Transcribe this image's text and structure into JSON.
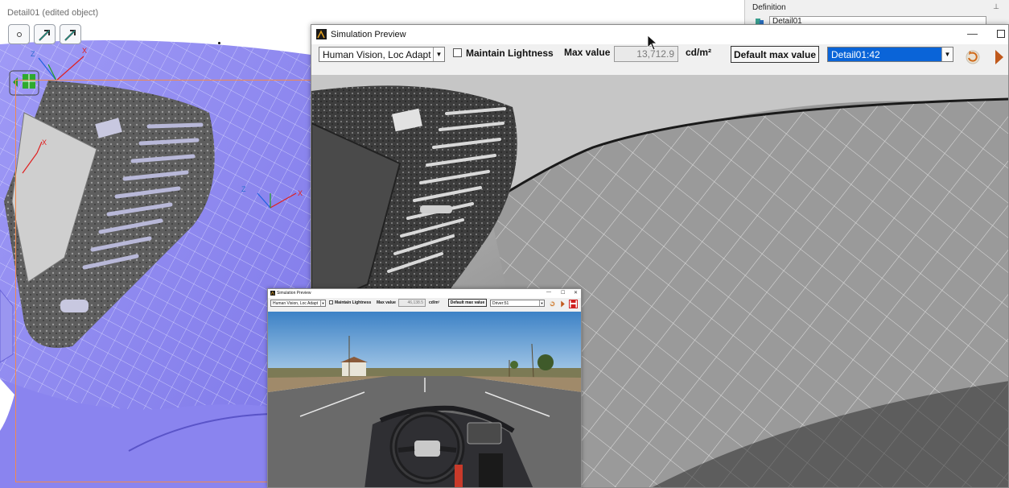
{
  "cad": {
    "title": "Detail01 (edited object)",
    "buttons": [
      "axis-orientation",
      "direction-arrow-a",
      "direction-arrow-b"
    ]
  },
  "definition_panel": {
    "title": "Definition",
    "field_value": "Detail01"
  },
  "main_window": {
    "title": "Simulation Preview",
    "vision_mode": "Human Vision, Loc Adapt",
    "maintain_lightness_label": "Maintain Lightness",
    "maintain_lightness_checked": false,
    "max_value_label": "Max value",
    "max_value": "13,712.9",
    "unit": "cd/m²",
    "default_max_button": "Default max value",
    "sensor_select": "Detail01:42",
    "min_glyph": "—",
    "max_glyph": ""
  },
  "small_window": {
    "title": "Simulation Preview",
    "vision_mode": "Human Vision, Loc Adapt",
    "maintain_lightness_label": "Maintain Lightness",
    "max_value_label": "Max value",
    "max_value": "46,138.5",
    "unit": "cd/m²",
    "default_max_button": "Default max value",
    "sensor_select": "Driver:51",
    "min_glyph": "—",
    "max_glyph": "☐",
    "close_glyph": "✕"
  },
  "colors": {
    "cad_surface": "#8c86f2",
    "selection_outline": "#f08a50",
    "selected_item": "#0a64d8",
    "play_arrow": "#c0591c"
  }
}
